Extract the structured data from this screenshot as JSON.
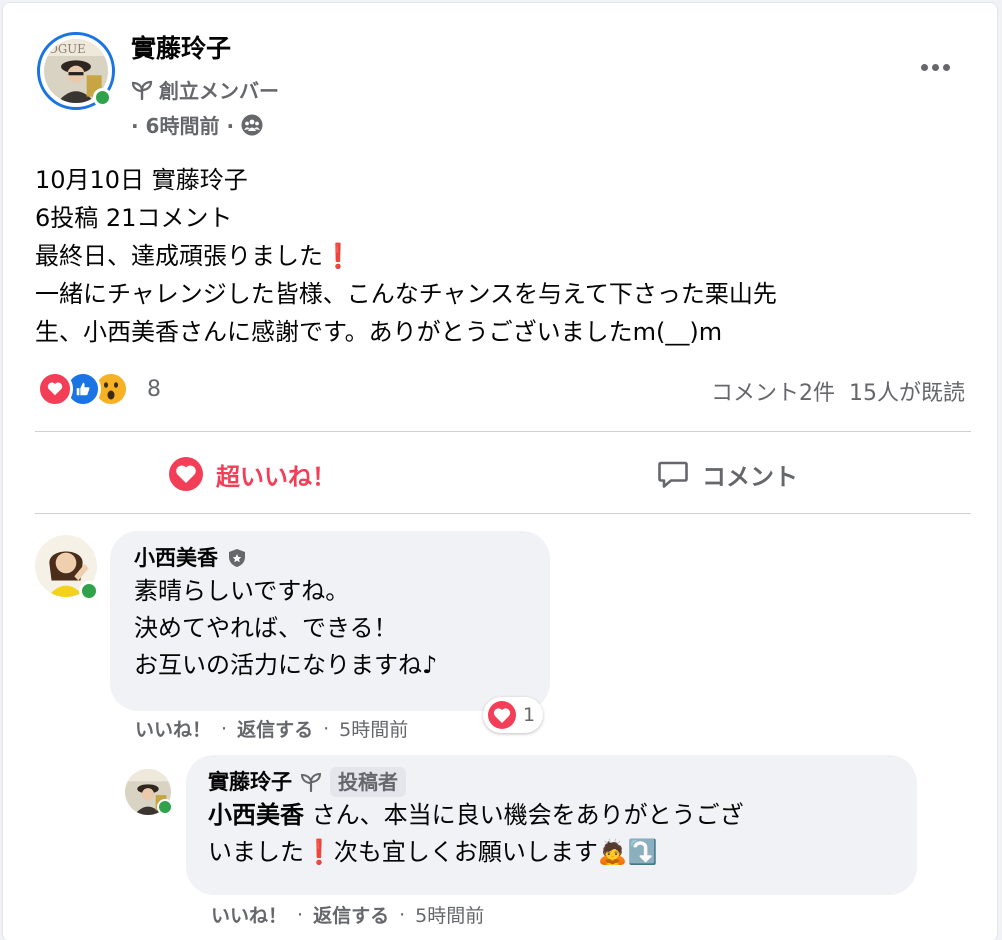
{
  "post": {
    "author": "實藤玲子",
    "badge": "創立メンバー",
    "time": "· 6時間前 ·",
    "body": [
      "10月10日 實藤玲子",
      "6投稿 21コメント",
      "最終日、達成頑張りました",
      "一緒にチャレンジした皆様、こんなチャンスを与えて下さった栗山先",
      "生、小西美香さんに感謝です。ありがとうございましたm(__)m"
    ],
    "exclamation": "❗",
    "reaction_count": "8",
    "comment_count": "コメント2件",
    "seen_count": "15人が既読",
    "icons": {
      "more": "more-dots-icon",
      "audience": "group-audience-icon",
      "badge": "sprout-icon"
    }
  },
  "actions": {
    "like": "超いいね！",
    "comment": "コメント"
  },
  "comments": [
    {
      "name": "小西美香",
      "lines": [
        "素晴らしいですね。",
        "決めてやれば、できる！",
        "お互いの活力になりますね♪"
      ],
      "like": "いいね！",
      "reply": "返信する",
      "time": "5時間前",
      "reaction_count": "1"
    }
  ],
  "reply": {
    "name": "實藤玲子",
    "tag": "投稿者",
    "mention": "小西美香",
    "line1_rest": " さん、本当に良い機会をありがとうござ",
    "line2_a": "いました",
    "line2_b": "次も宜しくお願いします",
    "emoji_bow": "🙇",
    "emoji_arrow": "⤵️",
    "like": "いいね！",
    "reply": "返信する",
    "time": "5時間前"
  },
  "separators": {
    "dot": "·"
  },
  "colors": {
    "accent_blue": "#1b74e4",
    "love_red": "#f33e58",
    "online_green": "#31a24c",
    "muted": "#65676b"
  }
}
